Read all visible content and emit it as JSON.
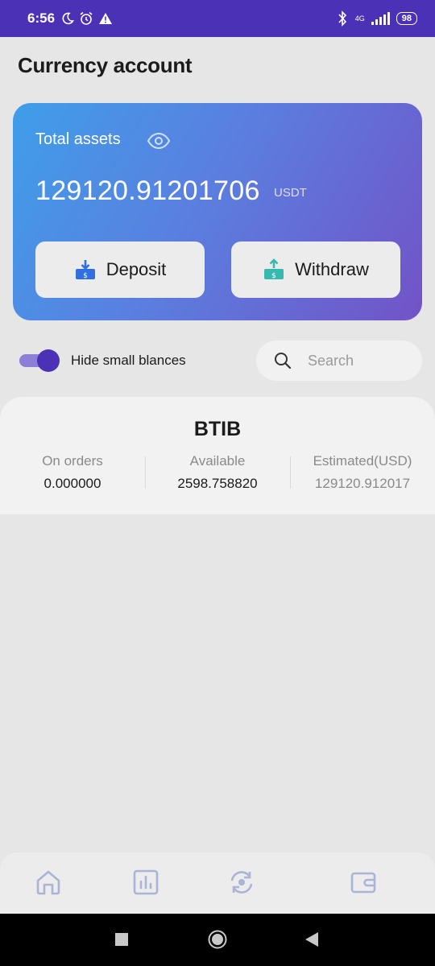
{
  "status_bar": {
    "time": "6:56",
    "network": "4G",
    "battery": "98"
  },
  "page": {
    "title": "Currency account"
  },
  "assets": {
    "label": "Total assets",
    "value": "129120.91201706",
    "unit": "USDT",
    "deposit_label": "Deposit",
    "withdraw_label": "Withdraw"
  },
  "filter": {
    "hide_small_label": "Hide small blances",
    "hide_small_on": true
  },
  "search": {
    "placeholder": "Search",
    "value": ""
  },
  "coin": {
    "name": "BTIB",
    "on_orders_label": "On orders",
    "on_orders_value": "0.000000",
    "available_label": "Available",
    "available_value": "2598.758820",
    "estimated_label": "Estimated(USD)",
    "estimated_value": "129120.912017"
  },
  "colors": {
    "accent": "#4b31b5",
    "card_start": "#3f9ee9",
    "card_end": "#7253c7",
    "nav_icon": "#a9b4d6"
  },
  "bottom_nav": {
    "icons": [
      "home-icon",
      "chart-icon",
      "exchange-icon",
      "wallet-icon"
    ]
  }
}
